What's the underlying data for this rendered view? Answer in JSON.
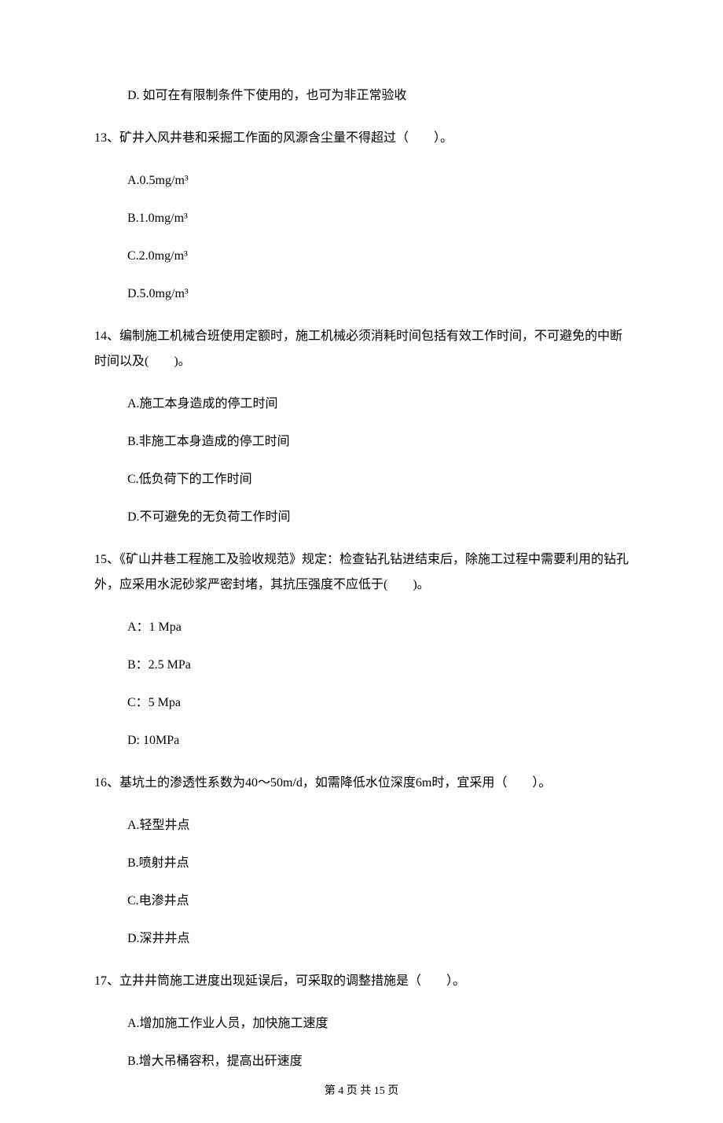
{
  "q12": {
    "options": {
      "d": "D. 如可在有限制条件下使用的，也可为非正常验收"
    }
  },
  "q13": {
    "text": "13、矿井入风井巷和采掘工作面的风源含尘量不得超过（　　）。",
    "options": {
      "a": "A.0.5mg/m³",
      "b": "B.1.0mg/m³",
      "c": "C.2.0mg/m³",
      "d": "D.5.0mg/m³"
    }
  },
  "q14": {
    "text": "14、编制施工机械合班使用定额时，施工机械必须消耗时间包括有效工作时间，不可避免的中断时间以及(　　)。",
    "options": {
      "a": "A.施工本身造成的停工时间",
      "b": "B.非施工本身造成的停工时间",
      "c": "C.低负荷下的工作时间",
      "d": "D.不可避免的无负荷工作时间"
    }
  },
  "q15": {
    "text": "15、《矿山井巷工程施工及验收规范》规定：检查钻孔钻进结束后，除施工过程中需要利用的钻孔外，应采用水泥砂浆严密封堵，其抗压强度不应低于(　　)。",
    "options": {
      "a": "A：1 Mpa",
      "b": "B：2.5 MPa",
      "c": "C：5 Mpa",
      "d": "D: 10MPa"
    }
  },
  "q16": {
    "text": "16、基坑土的渗透性系数为40～50m/d，如需降低水位深度6m时，宜采用（　　）。",
    "options": {
      "a": "A.轻型井点",
      "b": "B.喷射井点",
      "c": "C.电渗井点",
      "d": "D.深井井点"
    }
  },
  "q17": {
    "text": "17、立井井筒施工进度出现延误后，可采取的调整措施是（　　）。",
    "options": {
      "a": "A.增加施工作业人员，加快施工速度",
      "b": "B.增大吊桶容积，提高出矸速度"
    }
  },
  "footer": "第 4 页 共 15 页"
}
